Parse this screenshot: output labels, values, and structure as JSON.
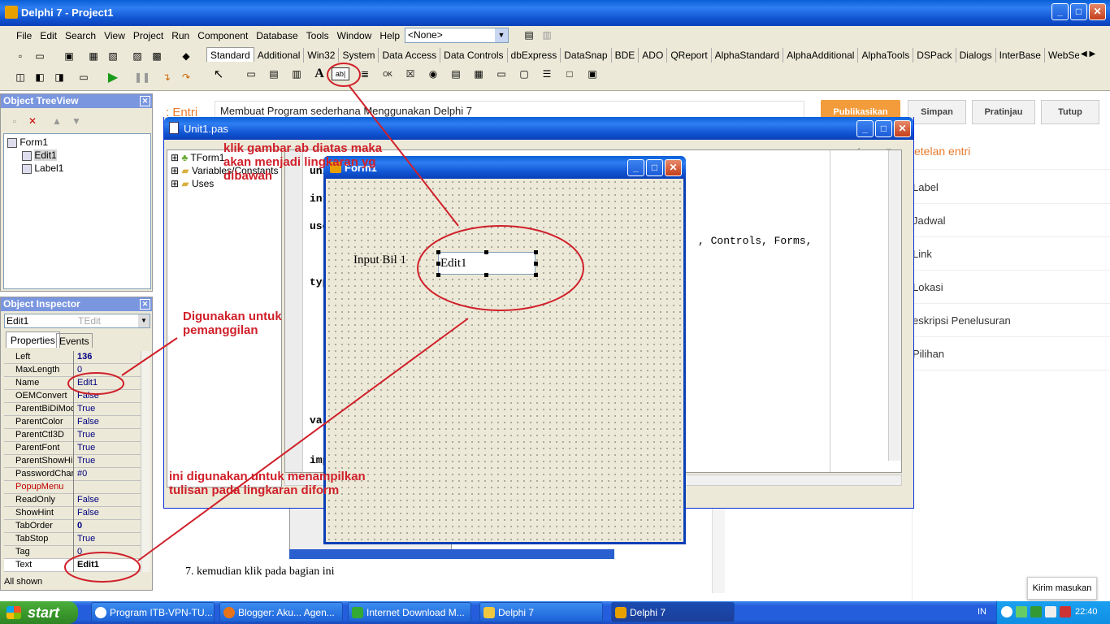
{
  "title": "Delphi 7 - Project1",
  "menu": [
    "File",
    "Edit",
    "Search",
    "View",
    "Project",
    "Run",
    "Component",
    "Database",
    "Tools",
    "Window",
    "Help"
  ],
  "toolbar": {
    "combo_value": "<None>"
  },
  "palette_tabs": [
    "Standard",
    "Additional",
    "Win32",
    "System",
    "Data Access",
    "Data Controls",
    "dbExpress",
    "DataSnap",
    "BDE",
    "ADO",
    "QReport",
    "AlphaStandard",
    "AlphaAdditional",
    "AlphaTools",
    "DSPack",
    "Dialogs",
    "InterBase",
    "WebServices"
  ],
  "blog": {
    "entry_label": ": Entri",
    "post_title": "Membuat Program sederhana Menggunakan Delphi 7",
    "publish": "Publikasikan",
    "save": "Simpan",
    "preview": "Pratinjau",
    "close": "Tutup",
    "settings_title": "etelan entri",
    "settings": [
      "Label",
      "Jadwal",
      "Link",
      "Lokasi",
      "eskripsi Penelusuran",
      "Pilihan"
    ],
    "step_text": "7.  kemudian klik pada bagian ini",
    "feedback": "Kirim masukan"
  },
  "treeview": {
    "title": "Object TreeView",
    "root": "Form1",
    "items": [
      "Edit1",
      "Label1"
    ]
  },
  "inspector": {
    "title": "Object Inspector",
    "object": "Edit1",
    "type": "TEdit",
    "tab_props": "Properties",
    "tab_events": "Events",
    "footer": "All shown",
    "rows": [
      [
        "Left",
        "136"
      ],
      [
        "MaxLength",
        "0"
      ],
      [
        "Name",
        "Edit1"
      ],
      [
        "OEMConvert",
        "False"
      ],
      [
        "ParentBiDiMod",
        "True"
      ],
      [
        "ParentColor",
        "False"
      ],
      [
        "ParentCtl3D",
        "True"
      ],
      [
        "ParentFont",
        "True"
      ],
      [
        "ParentShowHir",
        "True"
      ],
      [
        "PasswordChar",
        "#0"
      ],
      [
        "PopupMenu",
        ""
      ],
      [
        "ReadOnly",
        "False"
      ],
      [
        "ShowHint",
        "False"
      ],
      [
        "TabOrder",
        "0"
      ],
      [
        "TabStop",
        "True"
      ],
      [
        "Tag",
        "0"
      ],
      [
        "Text",
        "Edit1"
      ]
    ]
  },
  "unit": {
    "title": "Unit1.pas",
    "explorer": [
      "TForm1",
      "Variables/Constants",
      "Uses"
    ],
    "code_frags": [
      "uni",
      "int",
      "use",
      "typ",
      "var",
      "imp"
    ],
    "code_line": ", Controls, Forms,"
  },
  "form": {
    "title": "Form1",
    "label": "Input Bil 1",
    "edit": "Edit1"
  },
  "annotations": {
    "a1": "klik gambar ab diatas maka akan menjadi lingkaran yg dibawah",
    "a2": "Digunakan untuk pemanggilan",
    "a3": "ini digunakan untuk menampilkan tulisan pada lingkaran diform"
  },
  "taskbar": {
    "start": "start",
    "items": [
      "Program ITB-VPN-TU...",
      "Blogger: Aku... Agen...",
      "Internet Download M...",
      "Delphi 7",
      "Delphi 7"
    ],
    "lang": "IN",
    "time": "22:40"
  },
  "colors": {
    "accent": "#d0202a",
    "xp_blue": "#245edc",
    "publish": "#f39c3c"
  }
}
